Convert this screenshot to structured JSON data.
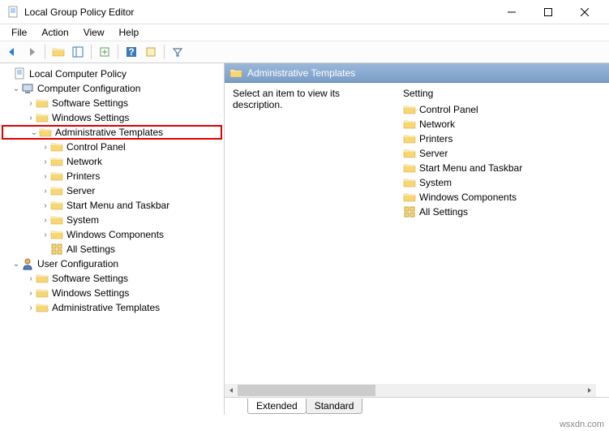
{
  "window": {
    "title": "Local Group Policy Editor"
  },
  "menu": {
    "file": "File",
    "action": "Action",
    "view": "View",
    "help": "Help"
  },
  "tree": {
    "root": "Local Computer Policy",
    "cc": "Computer Configuration",
    "cc_sw": "Software Settings",
    "cc_ws": "Windows Settings",
    "cc_at": "Administrative Templates",
    "cc_at_cp": "Control Panel",
    "cc_at_net": "Network",
    "cc_at_prn": "Printers",
    "cc_at_srv": "Server",
    "cc_at_smt": "Start Menu and Taskbar",
    "cc_at_sys": "System",
    "cc_at_wc": "Windows Components",
    "cc_at_all": "All Settings",
    "uc": "User Configuration",
    "uc_sw": "Software Settings",
    "uc_ws": "Windows Settings",
    "uc_at": "Administrative Templates"
  },
  "right": {
    "title": "Administrative Templates",
    "desc": "Select an item to view its description.",
    "col": "Setting",
    "items": {
      "0": "Control Panel",
      "1": "Network",
      "2": "Printers",
      "3": "Server",
      "4": "Start Menu and Taskbar",
      "5": "System",
      "6": "Windows Components",
      "7": "All Settings"
    }
  },
  "tabs": {
    "extended": "Extended",
    "standard": "Standard"
  },
  "watermark": "wsxdn.com"
}
